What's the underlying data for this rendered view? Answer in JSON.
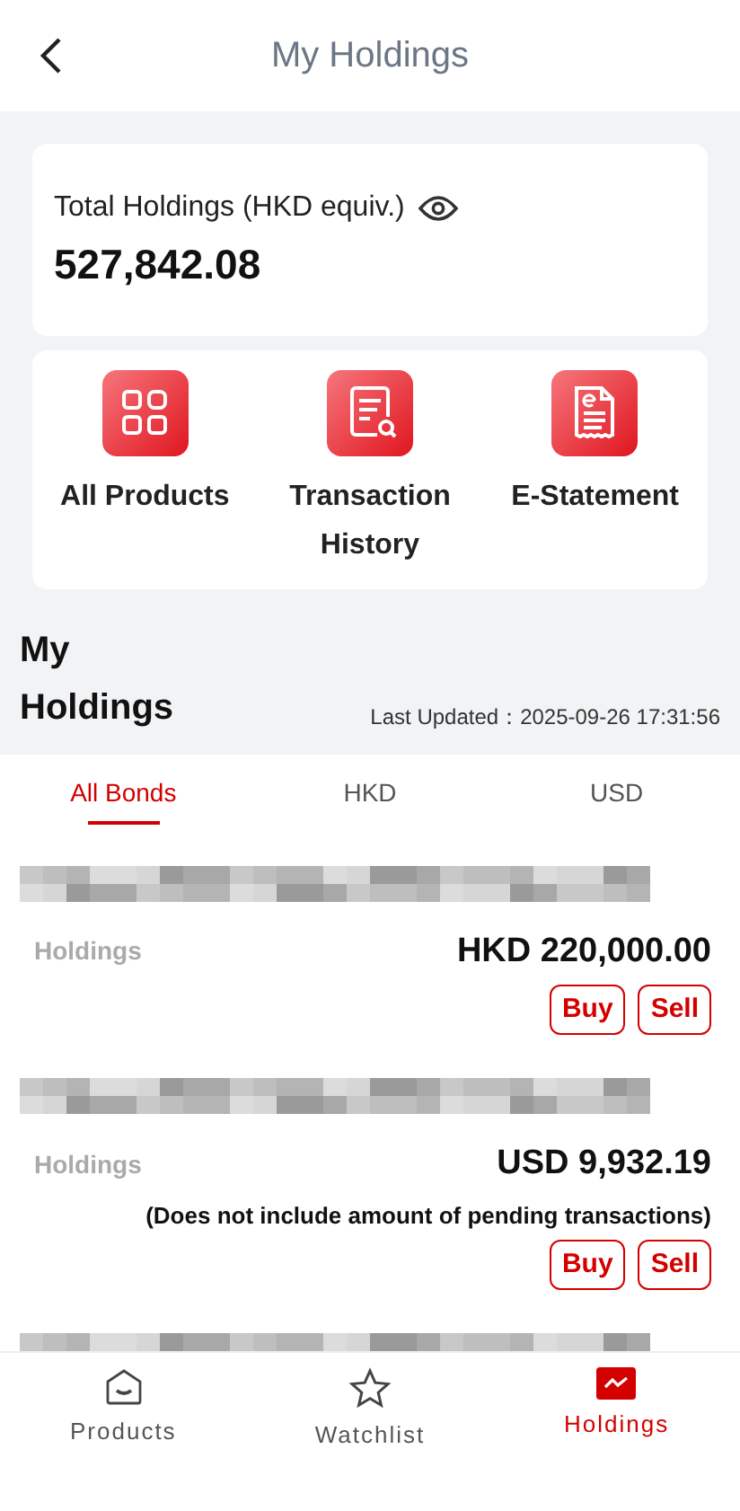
{
  "header": {
    "title": "My Holdings"
  },
  "total": {
    "label": "Total Holdings (HKD equiv.)",
    "value": "527,842.08",
    "visible": true
  },
  "shortcuts": [
    {
      "kind": "grid",
      "label": "All Products"
    },
    {
      "kind": "search",
      "label": "Transaction History"
    },
    {
      "kind": "statement",
      "label": "E-Statement"
    }
  ],
  "section": {
    "title": "My Holdings",
    "updated_label": "Last Updated：",
    "updated": "2025-09-26 17:31:56"
  },
  "tabs": [
    {
      "label": "All Bonds",
      "selected": true
    },
    {
      "label": "HKD",
      "selected": false
    },
    {
      "label": "USD",
      "selected": false
    }
  ],
  "holdings": [
    {
      "kind": "full",
      "label": "Holdings",
      "amount": "HKD 220,000.00",
      "buttons": [
        "Buy",
        "Sell"
      ]
    },
    {
      "kind": "full",
      "label": "Holdings",
      "amount": "USD 9,932.19",
      "note": "(Does not include amount of pending transactions)",
      "buttons": [
        "Buy",
        "Sell"
      ]
    },
    {
      "kind": "partial"
    }
  ],
  "nav": [
    {
      "kind": "products",
      "label": "Products",
      "selected": false
    },
    {
      "kind": "watchlist",
      "label": "Watchlist",
      "selected": false
    },
    {
      "kind": "holdings",
      "label": "Holdings",
      "selected": true
    }
  ]
}
